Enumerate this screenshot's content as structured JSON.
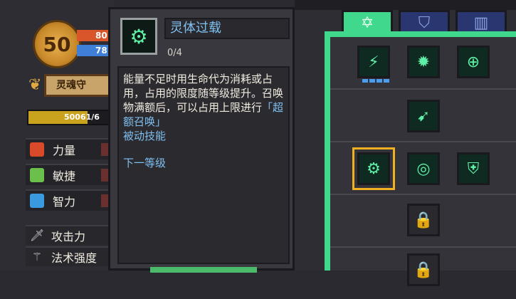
{
  "character": {
    "level": "50",
    "hp_partial": "80",
    "mp_partial": "78",
    "title_partial": "灵魂守",
    "xp_partial": "50061/6",
    "xp_fill_fraction": 0.7,
    "stats": [
      {
        "label": "力量",
        "icon": "fist-icon",
        "color": "#d84a2a"
      },
      {
        "label": "敏捷",
        "icon": "feather-icon",
        "color": "#6ac04a"
      },
      {
        "label": "智力",
        "icon": "book-icon",
        "color": "#3a9ae0"
      }
    ],
    "combat_stats": [
      {
        "label": "攻击力",
        "icon": "sword-icon"
      },
      {
        "label": "法术强度",
        "icon": "wand-icon"
      }
    ]
  },
  "tooltip": {
    "skill_name": "灵体过载",
    "level": "0/4",
    "desc_main": "能量不足时用生命代为消耗或占用，占用的限度随等级提升。召唤物满额后，可以占用上限进行",
    "desc_highlight": "「超额召唤」",
    "passive_label": "被动技能",
    "next_level_label": "下一等级"
  },
  "skill_tree": {
    "tabs": [
      {
        "icon": "star-of-david-icon",
        "glyph": "✡",
        "active": true
      },
      {
        "icon": "shield-icon",
        "glyph": "⛉",
        "active": false
      },
      {
        "icon": "door-icon",
        "glyph": "▥",
        "active": false
      }
    ],
    "accent": "#3fd88c"
  }
}
